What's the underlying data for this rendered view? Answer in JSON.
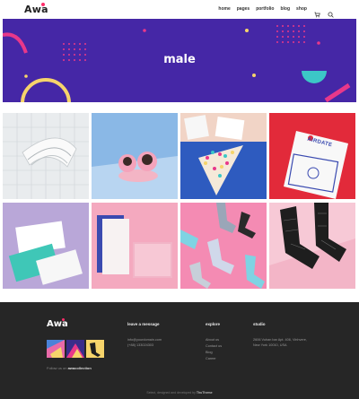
{
  "header": {
    "logo": "Awa",
    "nav": [
      "home",
      "pages",
      "portfolio",
      "blog",
      "shop"
    ],
    "icons": [
      "cart-icon",
      "search-icon"
    ]
  },
  "hero": {
    "title": "male",
    "colors": {
      "background": "#4527a6",
      "accent_pink": "#e8388a",
      "accent_teal": "#3cc7c7",
      "accent_yellow": "#f6d46b"
    }
  },
  "gallery": {
    "items": [
      {
        "alt": "white architecture"
      },
      {
        "alt": "pink dessert on blue"
      },
      {
        "alt": "sticker cone"
      },
      {
        "alt": "AIRDATE tag"
      },
      {
        "alt": "business cards"
      },
      {
        "alt": "pink boxes"
      },
      {
        "alt": "socks on pink"
      },
      {
        "alt": "black patterned socks"
      }
    ],
    "tag_text": "AIRDATE"
  },
  "footer": {
    "logo": "Awa",
    "follow_prefix": "Follow us on ",
    "follow_handle": "awacollection",
    "columns": [
      {
        "title": "leave a message",
        "lines": [
          "info@yourdomain.com",
          "(+88) 133024303"
        ]
      },
      {
        "title": "explore",
        "lines": [
          "About us",
          "Contact us",
          "Blog",
          "Career"
        ]
      },
      {
        "title": "studio",
        "lines": [
          "2606 Vuhan bar Apt. 406, Vinhvere,",
          "New York 10010, USA"
        ]
      }
    ],
    "copyright_prefix": "Select, designed and developed by ",
    "copyright_author": "ThuTheme"
  }
}
